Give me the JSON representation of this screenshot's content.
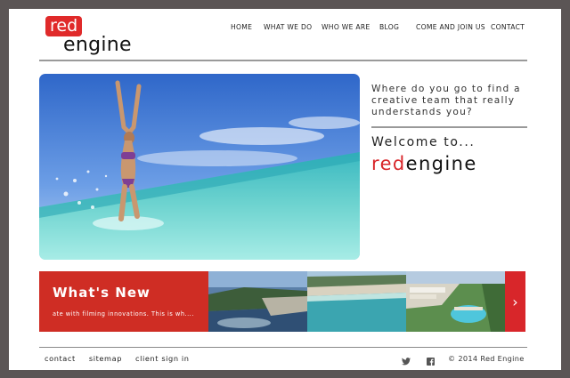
{
  "logo": {
    "red": "red",
    "engine": "engine"
  },
  "nav": {
    "items": [
      "HOME",
      "WHAT WE DO",
      "WHO WE ARE",
      "BLOG",
      "COME AND JOIN US",
      "CONTACT"
    ]
  },
  "hero": {
    "tagline": "Where do you go to find a creative team that really understands you?",
    "welcome": "Welcome to...",
    "brand_red": "red",
    "brand_engine": "engine"
  },
  "news": {
    "title": "What's New",
    "text": "ate with filming innovations. This is wh....",
    "next_icon": "chevron-right-icon"
  },
  "footer": {
    "links": [
      "contact",
      "sitemap",
      "client sign in"
    ],
    "social_icons": [
      "twitter-icon",
      "facebook-icon"
    ],
    "copyright": "© 2014 Red Engine"
  },
  "colors": {
    "brand_red": "#d8262a",
    "frame": "#5b5555",
    "sea": "#6fd4d0"
  }
}
